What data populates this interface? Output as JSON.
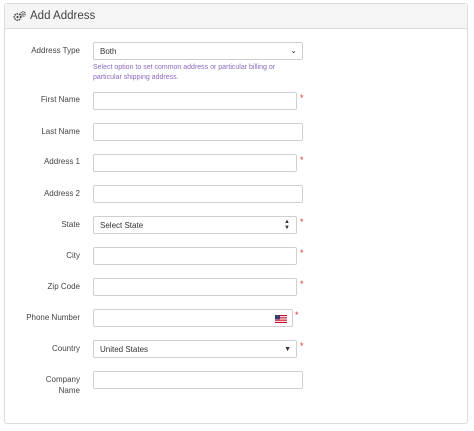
{
  "header": {
    "title": "Add Address",
    "icon": "cogs-icon"
  },
  "fields": {
    "address_type": {
      "label": "Address Type",
      "value": "Both",
      "help": "Select option to set common address or particular billing or particular shipping address."
    },
    "first_name": {
      "label": "First Name",
      "value": ""
    },
    "last_name": {
      "label": "Last Name",
      "value": ""
    },
    "address1": {
      "label": "Address 1",
      "value": ""
    },
    "address2": {
      "label": "Address 2",
      "value": ""
    },
    "state": {
      "label": "State",
      "value": "Select State"
    },
    "city": {
      "label": "City",
      "value": ""
    },
    "zip": {
      "label": "Zip Code",
      "value": ""
    },
    "phone": {
      "label": "Phone Number",
      "value": ""
    },
    "country": {
      "label": "Country",
      "value": "United States"
    },
    "company_line1": "Company",
    "company_line2": "Name"
  },
  "required_marker": "*",
  "colors": {
    "required": "#e03030",
    "help": "#8a6ac0",
    "header_bg": "#f5f5f5"
  }
}
